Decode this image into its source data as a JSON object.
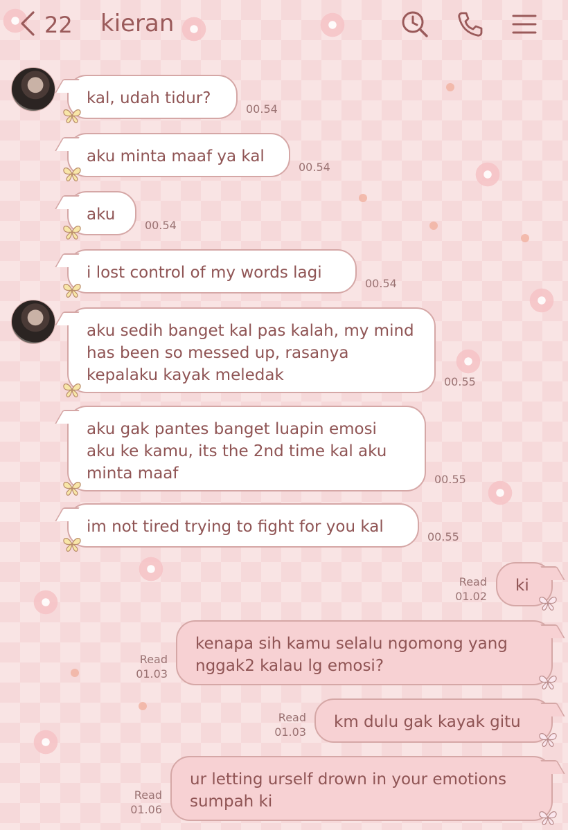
{
  "header": {
    "unread_count": "22",
    "contact_name": "kieran",
    "icons": [
      "chevron-left-icon",
      "search-clock-icon",
      "phone-icon",
      "menu-icon"
    ]
  },
  "messages": [
    {
      "text": "kal, udah tidur?",
      "time": "00.54"
    },
    {
      "text": "aku minta maaf ya kal",
      "time": "00.54"
    },
    {
      "text": "aku",
      "time": "00.54"
    },
    {
      "text": "i lost control of my words lagi",
      "time": "00.54"
    },
    {
      "text": "aku sedih banget kal pas kalah, my mind has been so messed up, rasanya kepalaku kayak meledak",
      "time": "00.55"
    },
    {
      "text": "aku gak pantes banget luapin emosi aku ke kamu, its the 2nd time kal aku minta maaf",
      "time": "00.55"
    },
    {
      "text": "im not tired trying to fight for you kal",
      "time": "00.55"
    },
    {
      "text": "ki",
      "status": "Read",
      "time": "01.02"
    },
    {
      "text": "kenapa sih kamu selalu ngomong yang nggak2 kalau lg emosi?",
      "status": "Read",
      "time": "01.03"
    },
    {
      "text": "km dulu gak kayak gitu",
      "status": "Read",
      "time": "01.03"
    },
    {
      "text": "ur letting urself drown in your emotions sumpah ki",
      "status": "Read",
      "time": "01.06"
    }
  ],
  "colors": {
    "accent": "#9a5a5a",
    "background": "#f6d9da",
    "incoming_bubble": "#ffffff",
    "outgoing_bubble": "#f7d1d3"
  }
}
